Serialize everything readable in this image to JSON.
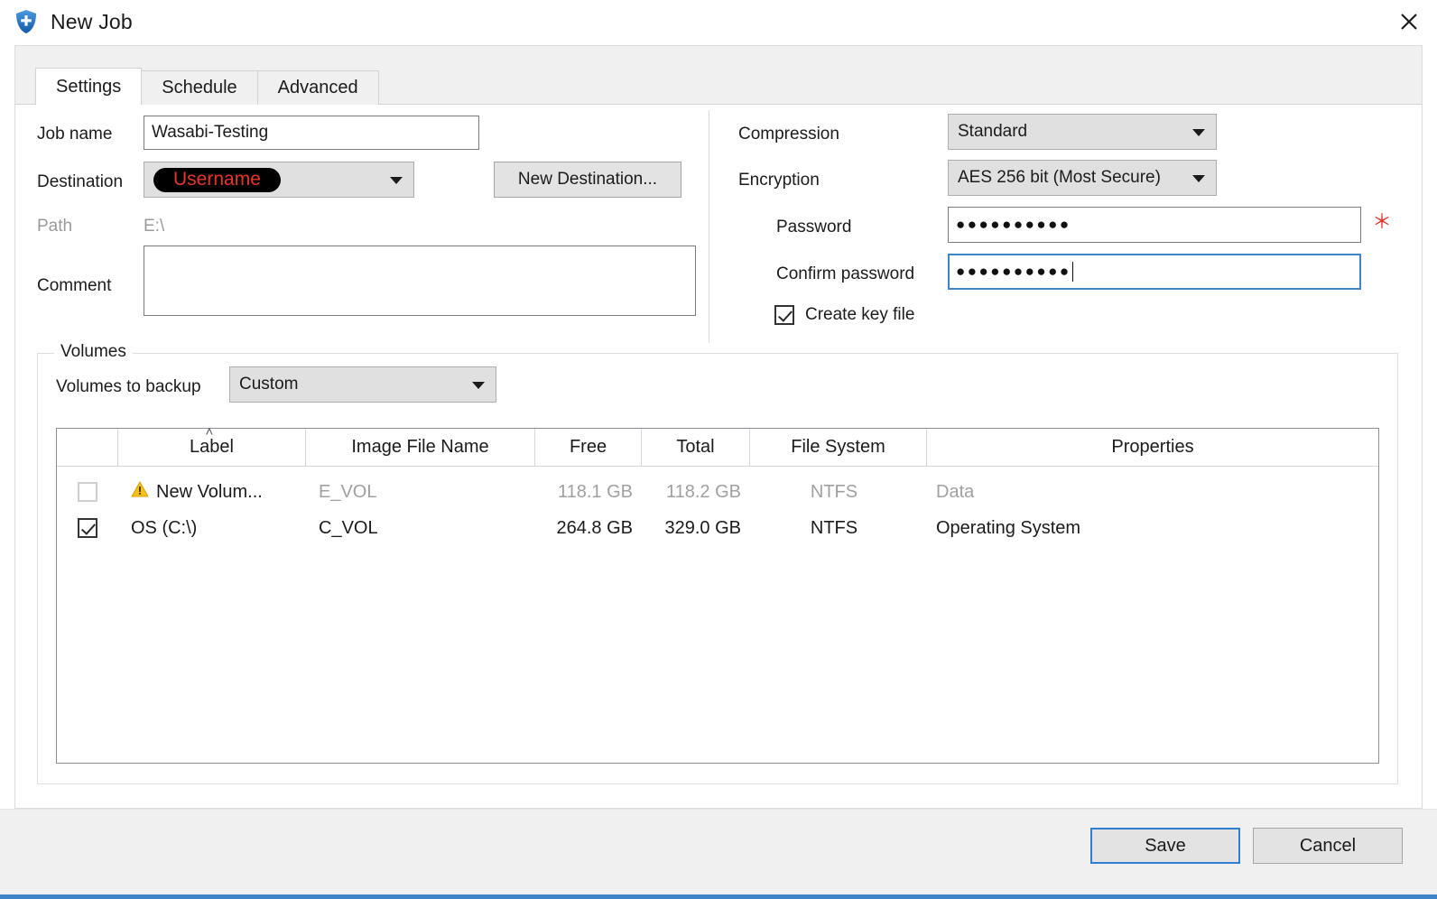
{
  "window": {
    "title": "New Job",
    "icon": "shield-plus-icon",
    "close_label": "✕",
    "accent_color": "#3d85c8"
  },
  "tabs": [
    {
      "label": "Settings",
      "active": true
    },
    {
      "label": "Schedule",
      "active": false
    },
    {
      "label": "Advanced",
      "active": false
    }
  ],
  "settings": {
    "job_name": {
      "label": "Job name",
      "value": "Wasabi-Testing",
      "placeholder": ""
    },
    "destination": {
      "label": "Destination",
      "value": "Username",
      "redacted": true,
      "redaction_color": "#000000",
      "value_color": "#e8352b",
      "button_label": "New Destination..."
    },
    "path": {
      "label": "Path",
      "value": "E:\\",
      "disabled": true
    },
    "comment": {
      "label": "Comment",
      "value": "",
      "placeholder": ""
    },
    "compression": {
      "label": "Compression",
      "value": "Standard"
    },
    "encryption": {
      "label": "Encryption",
      "value": "AES 256 bit (Most Secure)"
    },
    "password": {
      "label": "Password",
      "value": "●●●●●●●●●●",
      "required_marker": "＊",
      "focused": false
    },
    "confirm_password": {
      "label": "Confirm password",
      "value": "●●●●●●●●●●",
      "focused": true
    },
    "create_key_file": {
      "label": "Create key file",
      "checked": true
    }
  },
  "volumes": {
    "group_label": "Volumes",
    "selector": {
      "label": "Volumes to backup",
      "value": "Custom"
    },
    "sort_indicator": "˄",
    "columns": [
      {
        "key": "check",
        "label": ""
      },
      {
        "key": "label",
        "label": "Label"
      },
      {
        "key": "image_file",
        "label": "Image File Name"
      },
      {
        "key": "free",
        "label": "Free"
      },
      {
        "key": "total",
        "label": "Total"
      },
      {
        "key": "file_system",
        "label": "File System"
      },
      {
        "key": "properties",
        "label": "Properties"
      }
    ],
    "rows": [
      {
        "checked": false,
        "disabled": true,
        "warning": true,
        "label": "New Volum...",
        "image_file": "E_VOL",
        "free": "118.1 GB",
        "total": "118.2 GB",
        "file_system": "NTFS",
        "properties": "Data"
      },
      {
        "checked": true,
        "disabled": false,
        "warning": false,
        "label": "OS (C:\\)",
        "image_file": "C_VOL",
        "free": "264.8 GB",
        "total": "329.0 GB",
        "file_system": "NTFS",
        "properties": "Operating System"
      }
    ]
  },
  "footer": {
    "save_label": "Save",
    "cancel_label": "Cancel"
  }
}
